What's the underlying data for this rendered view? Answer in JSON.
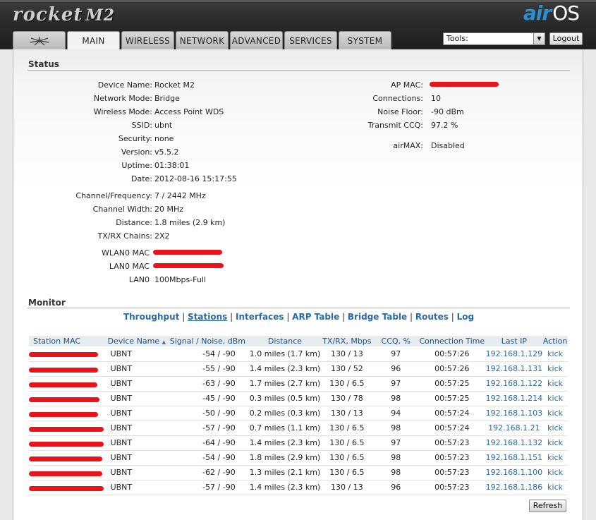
{
  "header": {
    "brand": "rocket",
    "model": "M2",
    "os_brand_air": "air",
    "os_brand_os": "OS"
  },
  "tabs": [
    {
      "label": ""
    },
    {
      "label": "MAIN"
    },
    {
      "label": "WIRELESS"
    },
    {
      "label": "NETWORK"
    },
    {
      "label": "ADVANCED"
    },
    {
      "label": "SERVICES"
    },
    {
      "label": "SYSTEM"
    }
  ],
  "tools": {
    "selected": "Tools:"
  },
  "logout_label": "Logout",
  "status": {
    "title": "Status",
    "left": [
      {
        "label": "Device Name:",
        "value": "Rocket M2"
      },
      {
        "label": "Network Mode:",
        "value": "Bridge"
      },
      {
        "label": "Wireless Mode:",
        "value": "Access Point WDS"
      },
      {
        "label": "SSID:",
        "value": "ubnt"
      },
      {
        "label": "Security:",
        "value": "none"
      },
      {
        "label": "Version:",
        "value": "v5.5.2"
      },
      {
        "label": "Uptime:",
        "value": "01:38:01"
      },
      {
        "label": "Date:",
        "value": "2012-08-16 15:17:55"
      },
      {
        "label": "Channel/Frequency:",
        "value": "7 / 2442 MHz"
      },
      {
        "label": "Channel Width:",
        "value": "20 MHz"
      },
      {
        "label": "Distance:",
        "value": "1.8 miles (2.9 km)"
      },
      {
        "label": "TX/RX Chains:",
        "value": "2X2"
      },
      {
        "label": "WLAN0 MAC",
        "value": ""
      },
      {
        "label": "LAN0 MAC",
        "value": ""
      },
      {
        "label": "LAN0",
        "value": "100Mbps-Full"
      }
    ],
    "right": [
      {
        "label": "AP MAC:",
        "value": ""
      },
      {
        "label": "Connections:",
        "value": "10"
      },
      {
        "label": "Noise Floor:",
        "value": "-90 dBm"
      },
      {
        "label": "Transmit CCQ:",
        "value": "97.2 %"
      },
      {
        "label": "airMAX:",
        "value": "Disabled"
      }
    ]
  },
  "monitor": {
    "title": "Monitor",
    "links": [
      "Throughput",
      "Stations",
      "Interfaces",
      "ARP Table",
      "Bridge Table",
      "Routes",
      "Log"
    ],
    "active_link": "Stations"
  },
  "stations": {
    "columns": [
      "Station MAC",
      "Device Name",
      "Signal / Noise, dBm",
      "Distance",
      "TX/RX, Mbps",
      "CCQ, %",
      "Connection Time",
      "Last IP",
      "Action"
    ],
    "sort_indicator": "▲",
    "rows": [
      {
        "name": "UBNT",
        "signal": "-54 / -90",
        "distance": "1.0 miles (1.7 km)",
        "txrx": "130 / 13",
        "ccq": "97",
        "time": "00:57:26",
        "ip": "192.168.1.129",
        "action": "kick"
      },
      {
        "name": "UBNT",
        "signal": "-55 / -90",
        "distance": "1.4 miles (2.3 km)",
        "txrx": "130 / 52",
        "ccq": "96",
        "time": "00:57:26",
        "ip": "192.168.1.131",
        "action": "kick"
      },
      {
        "name": "UBNT",
        "signal": "-63 / -90",
        "distance": "1.7 miles (2.7 km)",
        "txrx": "130 / 6.5",
        "ccq": "97",
        "time": "00:57:25",
        "ip": "192.168.1.122",
        "action": "kick"
      },
      {
        "name": "UBNT",
        "signal": "-45 / -90",
        "distance": "0.3 miles (0.5 km)",
        "txrx": "130 / 78",
        "ccq": "98",
        "time": "00:57:25",
        "ip": "192.168.1.214",
        "action": "kick"
      },
      {
        "name": "UBNT",
        "signal": "-50 / -90",
        "distance": "0.2 miles (0.3 km)",
        "txrx": "130 / 13",
        "ccq": "94",
        "time": "00:57:24",
        "ip": "192.168.1.103",
        "action": "kick"
      },
      {
        "name": "UBNT",
        "signal": "-57 / -90",
        "distance": "0.7 miles (1.1 km)",
        "txrx": "130 / 6.5",
        "ccq": "98",
        "time": "00:57:24",
        "ip": "192.168.1.21",
        "action": "kick"
      },
      {
        "name": "UBNT",
        "signal": "-64 / -90",
        "distance": "1.4 miles (2.3 km)",
        "txrx": "130 / 6.5",
        "ccq": "97",
        "time": "00:57:23",
        "ip": "192.168.1.132",
        "action": "kick"
      },
      {
        "name": "UBNT",
        "signal": "-54 / -90",
        "distance": "1.8 miles (2.9 km)",
        "txrx": "130 / 6.5",
        "ccq": "98",
        "time": "00:57:23",
        "ip": "192.168.1.151",
        "action": "kick"
      },
      {
        "name": "UBNT",
        "signal": "-62 / -90",
        "distance": "1.3 miles (2.1 km)",
        "txrx": "130 / 6.5",
        "ccq": "98",
        "time": "00:57:23",
        "ip": "192.168.1.100",
        "action": "kick"
      },
      {
        "name": "UBNT",
        "signal": "-57 / -90",
        "distance": "1.4 miles (2.3 km)",
        "txrx": "130 / 13",
        "ccq": "96",
        "time": "00:57:23",
        "ip": "192.168.1.186",
        "action": "kick"
      }
    ]
  },
  "refresh_label": "Refresh",
  "colors": {
    "accent": "#2a6aa8",
    "redaction": "#e8141c",
    "brand_blue": "#2b8fd6"
  }
}
